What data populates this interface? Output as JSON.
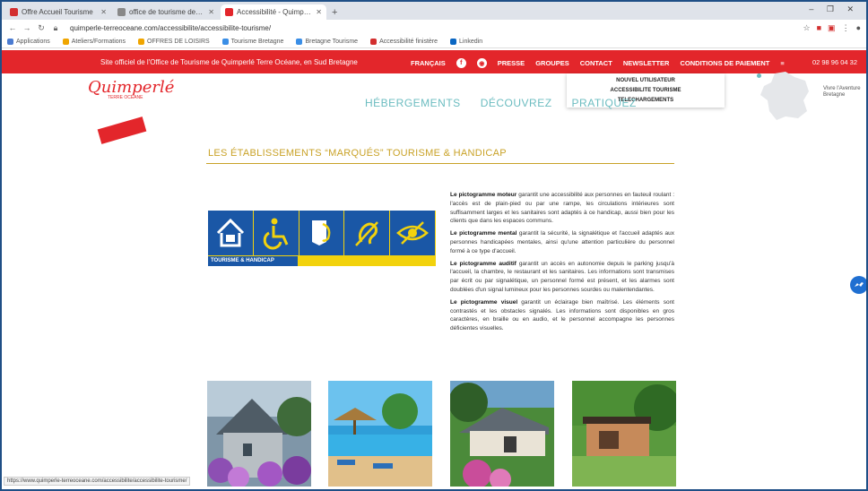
{
  "browser": {
    "tabs": [
      {
        "title": "Offre Accueil Tourisme",
        "color": "#d32f2f",
        "active": false
      },
      {
        "title": "office de tourisme de quimperlé",
        "color": "#888888",
        "active": false
      },
      {
        "title": "Accessibilité - Quimperlé Terre Océane",
        "color": "#e3262b",
        "active": true
      }
    ],
    "new_tab": "+",
    "window_controls": "– ❐ ✕",
    "url": "quimperle-terreoceane.com/accessibilite/accessibilite-tourisme/",
    "bookmarks": [
      {
        "label": "Applications",
        "color": "#4a7bd1"
      },
      {
        "label": "Ateliers/Formations",
        "color": "#f0a500"
      },
      {
        "label": "OFFRES DE LOISIRS",
        "color": "#f0a500"
      },
      {
        "label": "Tourisme Bretagne",
        "color": "#3a8ee6"
      },
      {
        "label": "Bretagne Tourisme",
        "color": "#3a8ee6"
      },
      {
        "label": "Accessibilité finistère",
        "color": "#d32f2f"
      },
      {
        "label": "Linkedin",
        "color": "#0a66c2"
      }
    ]
  },
  "site": {
    "tagline": "Site officiel de l'Office de Tourisme de Quimperlé Terre Océane, en Sud Bretagne",
    "top_menu": [
      "PRESSE",
      "GROUPES",
      "CONTACT",
      "NEWSLETTER",
      "CONDITIONS DE PAIEMENT"
    ],
    "social": [
      "f",
      "◉"
    ],
    "phone": "02 98 96 04 32",
    "dropdown": [
      "NOUVEL UTILISATEUR",
      "ACCESSIBILITE TOURISME",
      "TELECHARGEMENTS"
    ],
    "logo_text": "Quimperlé",
    "logo_sub": "TERRE OCÉANE",
    "main_nav": [
      "HÉBERGEMENTS",
      "DÉCOUVREZ",
      "PRATIQUEZ"
    ],
    "side_logo": "Vivre l'Aventure Bretagne"
  },
  "content": {
    "title": "LES ÉTABLISSEMENTS “MARQUÉS” TOURISME & HANDICAP",
    "banner_label": "TOURISME & HANDICAP",
    "paragraphs": [
      {
        "lead": "Le pictogramme moteur",
        "text": " garantit une accessibilité aux personnes en fauteuil roulant : l'accès est de plain-pied ou par une rampe, les circulations intérieures sont suffisamment larges et les sanitaires sont adaptés à ce handicap, aussi bien pour les clients que dans les espaces communs."
      },
      {
        "lead": "Le pictogramme mental",
        "text": " garantit la sécurité, la signalétique et l'accueil adaptés aux personnes handicapées mentales, ainsi qu'une attention particulière du personnel formé à ce type d'accueil."
      },
      {
        "lead": "Le pictogramme auditif",
        "text": " garantit un accès en autonomie depuis le parking jusqu'à l'accueil, la chambre, le restaurant et les sanitaires. Les informations sont transmises par écrit ou par signalétique, un personnel formé est présent, et les alarmes sont doublées d'un signal lumineux pour les personnes sourdes ou malentendantes."
      },
      {
        "lead": "Le pictogramme visuel",
        "text": " garantit un éclairage bien maîtrisé. Les éléments sont contrastés et les obstacles signalés. Les informations sont disponibles en gros caractères, en braille ou en audio, et le personnel accompagne les personnes déficientes visuelles."
      }
    ],
    "photos": [
      "maison-hortensias",
      "piscine-camping",
      "maison-jardin",
      "chalet-bois"
    ]
  },
  "status_url": "https://www.quimperle-terreoceane.com/accessibilite/accessibilite-tourisme/",
  "colors": {
    "brand_red": "#e3262b",
    "gold": "#c9a227",
    "teal": "#6bbcc0",
    "th_yellow": "#f2d20d",
    "th_blue": "#1a57a6"
  }
}
